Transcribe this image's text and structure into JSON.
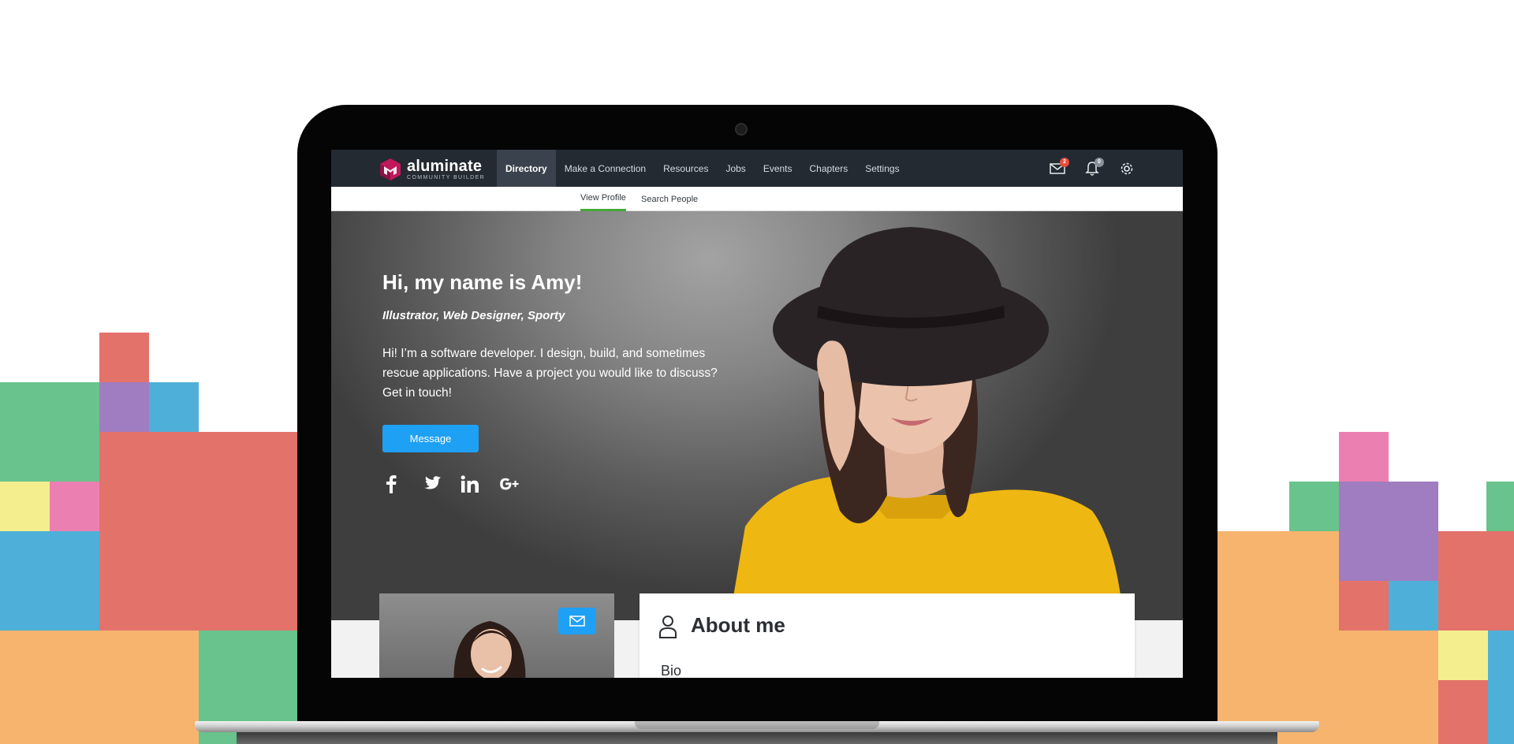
{
  "colors": {
    "nav_bg": "#232a31",
    "nav_active_bg": "#3a434d",
    "accent_blue": "#1ea0f5",
    "subnav_active": "#44a83a",
    "badge_red": "#e74c3c",
    "badge_grey": "#8a9097",
    "logo_magenta": "#c2185b",
    "block_red": "#e3726b",
    "block_green": "#69c38c",
    "block_blue": "#4eb0d8",
    "block_orange": "#f6b46f",
    "block_purple": "#a07cc0",
    "block_pink": "#ec7fb1",
    "block_yellow": "#f4ee8f"
  },
  "logo": {
    "name": "aluminate",
    "subtitle": "COMMUNITY BUILDER"
  },
  "nav": {
    "items": [
      {
        "label": "Directory",
        "active": true
      },
      {
        "label": "Make a Connection",
        "active": false
      },
      {
        "label": "Resources",
        "active": false
      },
      {
        "label": "Jobs",
        "active": false
      },
      {
        "label": "Events",
        "active": false
      },
      {
        "label": "Chapters",
        "active": false
      },
      {
        "label": "Settings",
        "active": false
      }
    ],
    "icons": [
      {
        "name": "mail-icon",
        "badge": "2"
      },
      {
        "name": "bell-icon",
        "badge": "0"
      },
      {
        "name": "gear-icon",
        "badge": ""
      }
    ]
  },
  "subnav": {
    "tabs": [
      {
        "label": "View Profile",
        "active": true
      },
      {
        "label": "Search People",
        "active": false
      }
    ]
  },
  "hero": {
    "title": "Hi, my name is Amy!",
    "tagline": "Illustrator, Web Designer, Sporty",
    "bio": "Hi! I’m a software developer. I design, build, and sometimes rescue applications. Have a project you would like to discuss? Get in touch!",
    "message_button": "Message",
    "social": [
      "facebook-icon",
      "twitter-icon",
      "linkedin-icon",
      "google-plus-icon"
    ]
  },
  "about": {
    "title": "About me",
    "bio_label": "Bio"
  }
}
